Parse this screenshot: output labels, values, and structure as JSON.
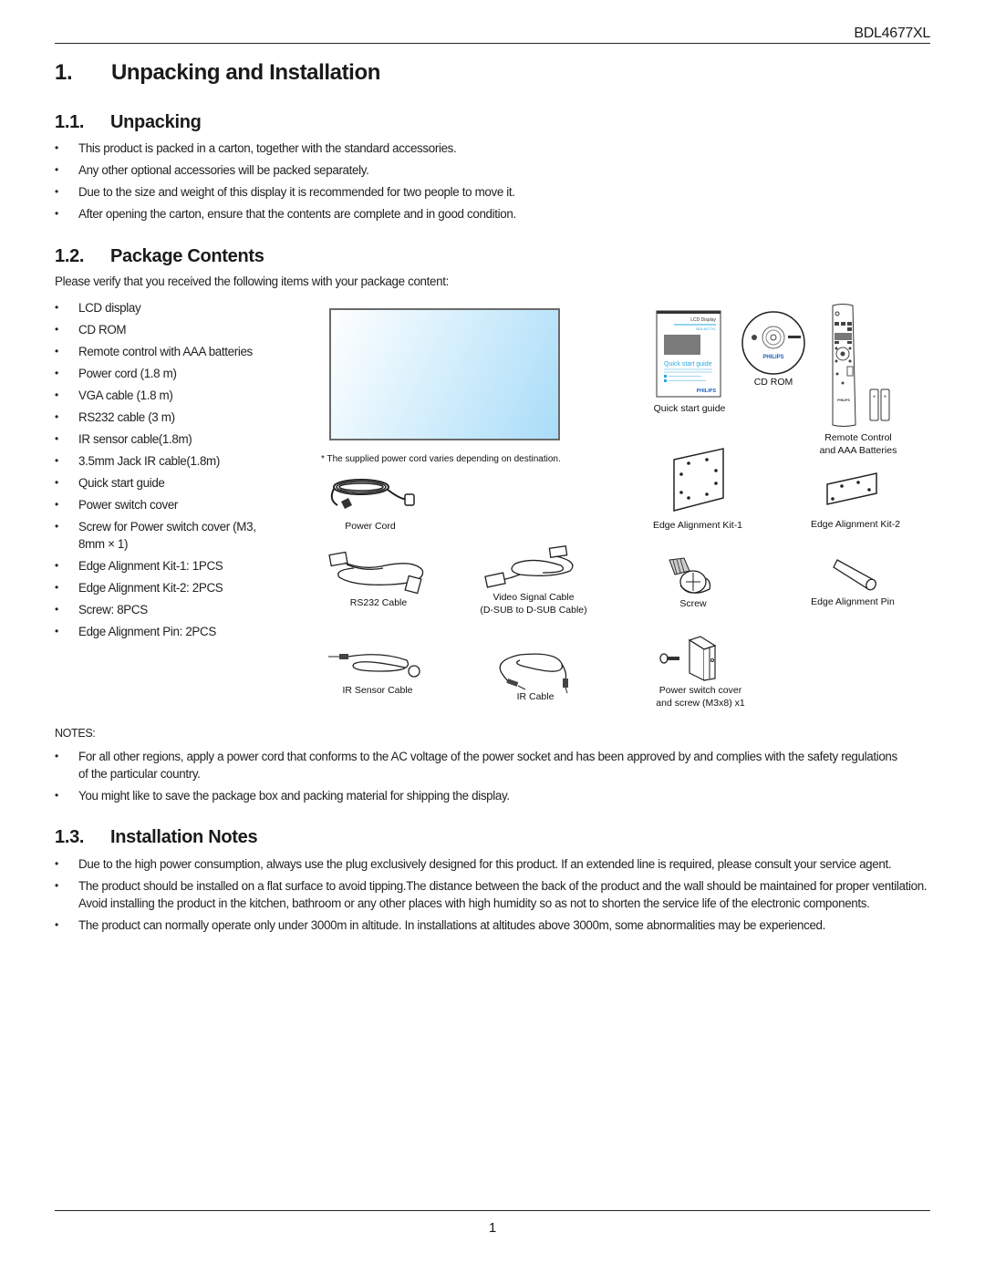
{
  "header": {
    "model": "BDL4677XL"
  },
  "chapter": {
    "number": "1.",
    "title": "Unpacking and Installation"
  },
  "unpacking": {
    "number": "1.1.",
    "title": "Unpacking",
    "bullets": [
      "This product is packed in a carton, together with the standard accessories.",
      "Any other optional accessories will be packed separately.",
      "Due to the size and weight of this display it is recommended for two people to move it.",
      "After opening the carton, ensure that the contents are complete and in good condition."
    ]
  },
  "package_contents": {
    "number": "1.2.",
    "title": "Package Contents",
    "intro": "Please verify that you received the following items with your package content:",
    "items": [
      "LCD display",
      "CD ROM",
      "Remote control with AAA batteries",
      "Power cord (1.8 m)",
      "VGA cable (1.8 m)",
      "RS232 cable (3 m)",
      "IR sensor cable(1.8m)",
      "3.5mm Jack IR cable(1.8m)",
      "Quick start guide",
      "Power switch cover",
      "Screw for Power switch cover (M3, 8mm × 1)",
      "Edge Alignment Kit-1: 1PCS",
      "Edge Alignment Kit-2: 2PCS",
      "Screw: 8PCS",
      "Edge Alignment Pin: 2PCS"
    ],
    "figure": {
      "power_cord_note": "* The supplied power cord varies depending on destination.",
      "captions": {
        "quick_start_guide": "Quick start guide",
        "cd_rom": "CD ROM",
        "remote_line1": "Remote Control",
        "remote_line2": "and AAA Batteries",
        "power_cord": "Power Cord",
        "edge_kit_1": "Edge Alignment Kit-1",
        "edge_kit_2": "Edge Alignment Kit-2",
        "rs232_cable": "RS232 Cable",
        "video_line1": "Video Signal Cable",
        "video_line2": "(D-SUB to D-SUB Cable)",
        "screw": "Screw",
        "edge_pin": "Edge Alignment Pin",
        "ir_sensor_cable": "IR Sensor Cable",
        "ir_cable": "IR Cable",
        "psc_line1": "Power switch cover",
        "psc_line2": "and screw (M3x8) x1"
      },
      "guide_cover": {
        "title": "LCD Display",
        "model": "BDL4677XL",
        "heading": "Quick start guide",
        "brand": "PHILIPS"
      },
      "cd_brand": "PHILIPS",
      "remote_brand": "PHILIPS"
    },
    "notes_label": "NOTES:",
    "notes": [
      "For all other regions, apply a power cord that conforms to the AC voltage of the power socket and has been approved by and complies with the safety regulations of the particular country.",
      "You might like to save the package box and packing material for shipping the display."
    ]
  },
  "installation_notes": {
    "number": "1.3.",
    "title": "Installation Notes",
    "bullets": [
      "Due to the high power consumption, always use the plug exclusively designed for this product. If an extended line is required, please consult your service agent.",
      "The product should be installed on a flat surface to avoid tipping.The distance between the back of the product and the wall should be maintained for proper ventilation. Avoid installing the product in the kitchen, bathroom or any other places with high humidity so as not to shorten the service life of the electronic components.",
      "The product can normally operate only under 3000m in altitude. In installations at altitudes above 3000m, some abnormalities may be experienced."
    ]
  },
  "footer": {
    "page_number": "1"
  },
  "colors": {
    "lcd_light": "#ffffff",
    "lcd_blue": "#a9dcf8",
    "guide_blue": "#29a8e0",
    "philips_blue": "#1f5fbf"
  }
}
